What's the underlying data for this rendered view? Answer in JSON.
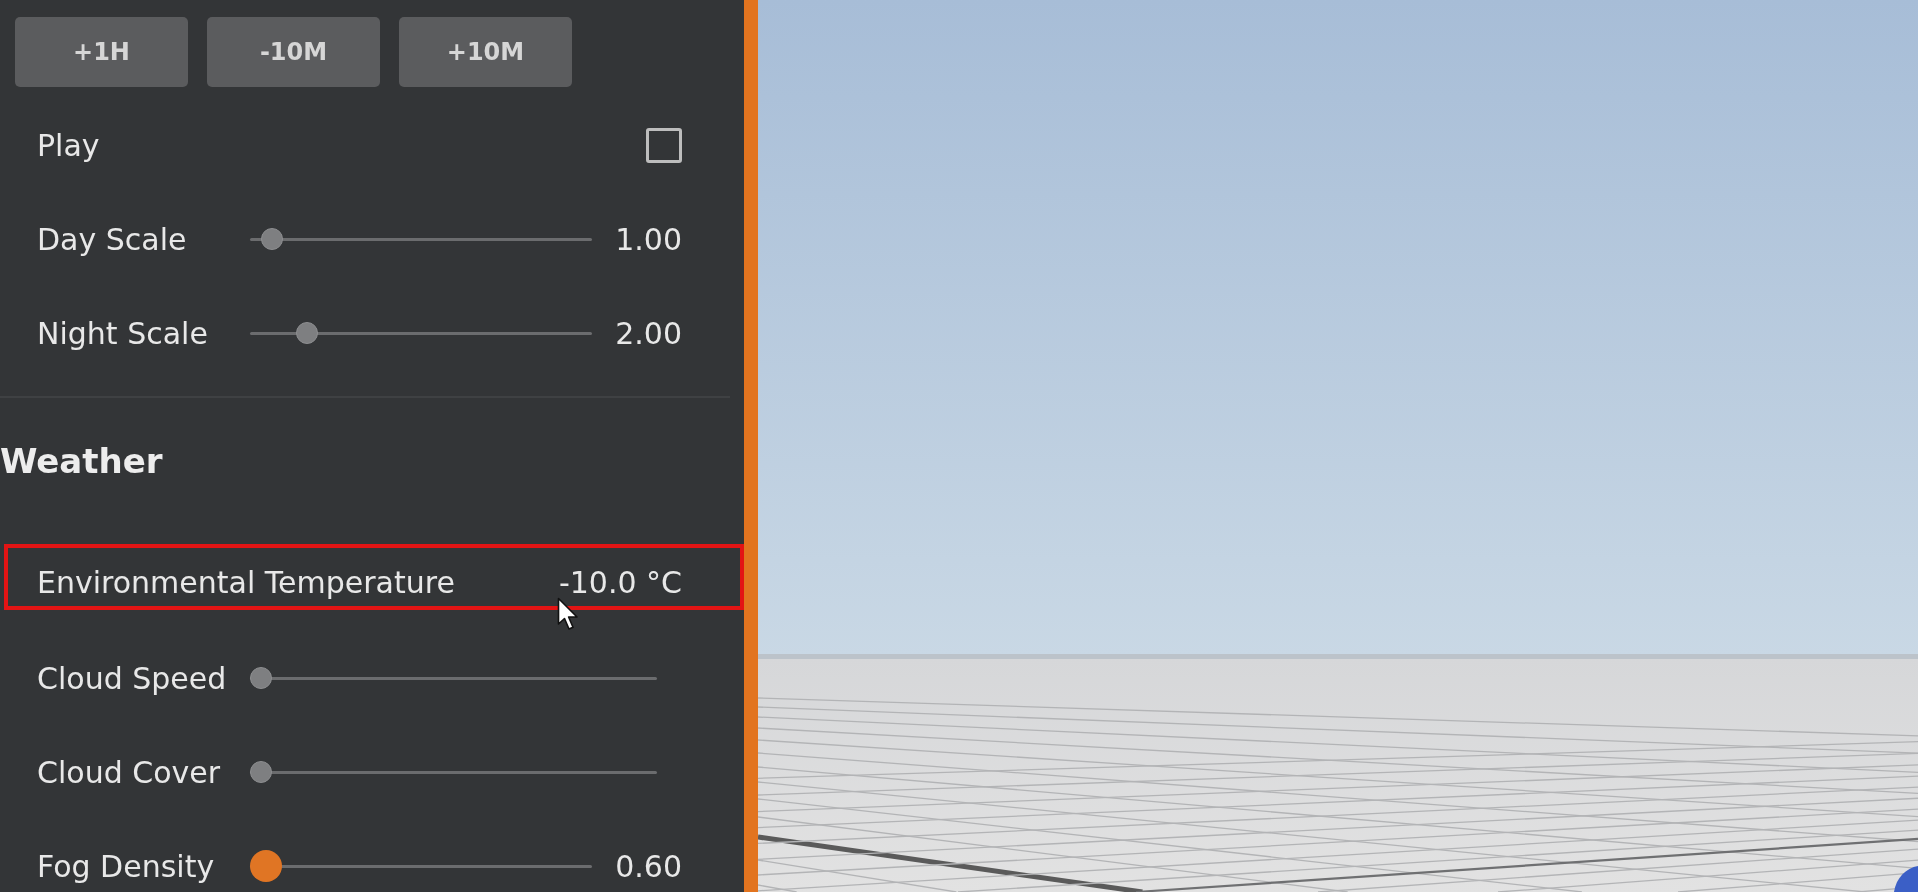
{
  "time_buttons": [
    {
      "label": "+1H"
    },
    {
      "label": "-10M"
    },
    {
      "label": "+10M"
    }
  ],
  "time_settings": [
    {
      "kind": "checkbox",
      "label": "Play",
      "checked": false
    },
    {
      "kind": "slider",
      "label": "Day Scale",
      "level": 0.035,
      "focused": false,
      "reading": "1.00"
    },
    {
      "kind": "slider",
      "label": "Night Scale",
      "level": 0.145,
      "focused": false,
      "reading": "2.00"
    }
  ],
  "weather": {
    "title": "Weather",
    "settings": [
      {
        "kind": "value",
        "label": "Environmental Temperature",
        "reading": "-10.0 °C",
        "highlighted": true
      },
      {
        "kind": "slider",
        "label": "Cloud Speed",
        "level": 0,
        "focused": false,
        "highlighted": false
      },
      {
        "kind": "slider",
        "label": "Cloud Cover",
        "level": 0,
        "focused": false,
        "highlighted": false
      },
      {
        "kind": "slider",
        "label": "Fog Density",
        "level": 0,
        "focused": true,
        "reading": "0.60",
        "highlighted": false
      }
    ]
  }
}
